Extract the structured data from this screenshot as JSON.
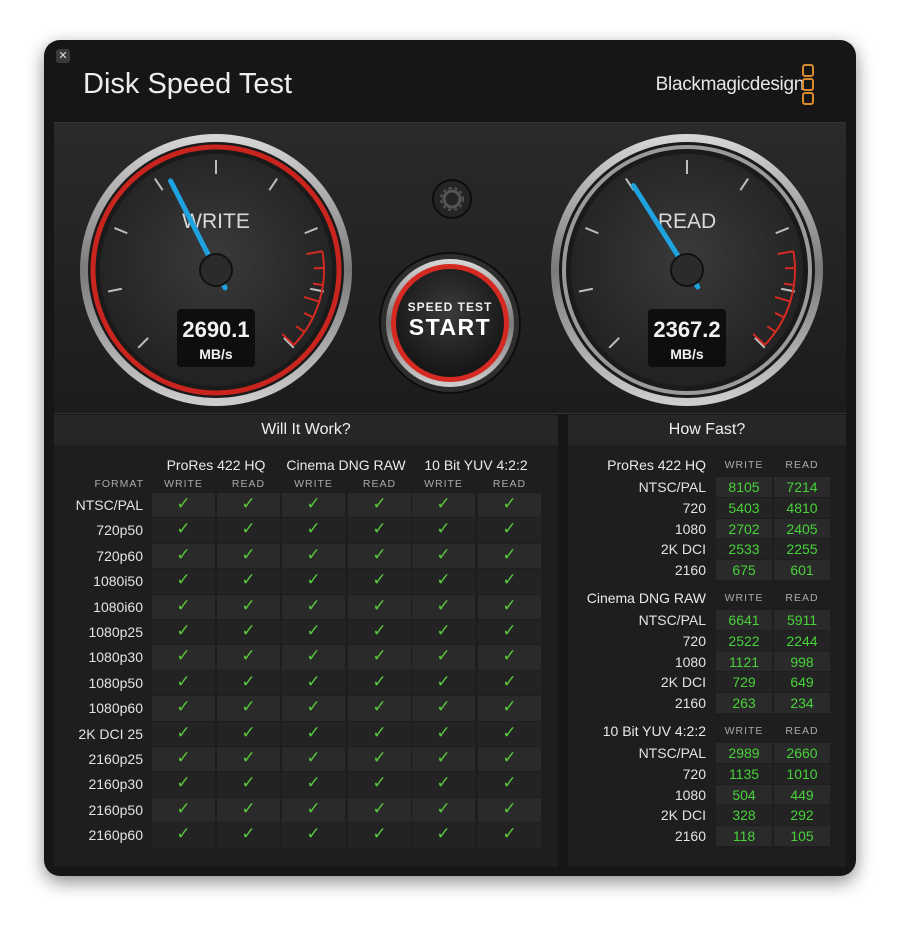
{
  "window": {
    "title": "Disk Speed Test",
    "brand": "Blackmagicdesign",
    "close_icon": "close-icon"
  },
  "gauges": {
    "write": {
      "label": "WRITE",
      "value": "2690.1",
      "unit": "MB/s",
      "needle_fraction": 0.4
    },
    "read": {
      "label": "READ",
      "value": "2367.2",
      "unit": "MB/s",
      "needle_fraction": 0.38
    }
  },
  "start_button": {
    "line1": "SPEED TEST",
    "line2": "START"
  },
  "settings_icon": "gear-icon",
  "will_it_work": {
    "title": "Will It Work?",
    "format_header": "FORMAT",
    "codecs": [
      "ProRes 422 HQ",
      "Cinema DNG RAW",
      "10 Bit YUV 4:2:2"
    ],
    "subcols": [
      "WRITE",
      "READ",
      "WRITE",
      "READ",
      "WRITE",
      "READ"
    ],
    "formats": [
      "NTSC/PAL",
      "720p50",
      "720p60",
      "1080i50",
      "1080i60",
      "1080p25",
      "1080p30",
      "1080p50",
      "1080p60",
      "2K DCI 25",
      "2160p25",
      "2160p30",
      "2160p50",
      "2160p60"
    ],
    "check_glyph": "✓"
  },
  "how_fast": {
    "title": "How Fast?",
    "write_label": "WRITE",
    "read_label": "READ",
    "groups": [
      {
        "codec": "ProRes 422 HQ",
        "rows": [
          {
            "format": "NTSC/PAL",
            "write": "8105",
            "read": "7214"
          },
          {
            "format": "720",
            "write": "5403",
            "read": "4810"
          },
          {
            "format": "1080",
            "write": "2702",
            "read": "2405"
          },
          {
            "format": "2K DCI",
            "write": "2533",
            "read": "2255"
          },
          {
            "format": "2160",
            "write": "675",
            "read": "601"
          }
        ]
      },
      {
        "codec": "Cinema DNG RAW",
        "rows": [
          {
            "format": "NTSC/PAL",
            "write": "6641",
            "read": "5911"
          },
          {
            "format": "720",
            "write": "2522",
            "read": "2244"
          },
          {
            "format": "1080",
            "write": "1121",
            "read": "998"
          },
          {
            "format": "2K DCI",
            "write": "729",
            "read": "649"
          },
          {
            "format": "2160",
            "write": "263",
            "read": "234"
          }
        ]
      },
      {
        "codec": "10 Bit YUV 4:2:2",
        "rows": [
          {
            "format": "NTSC/PAL",
            "write": "2989",
            "read": "2660"
          },
          {
            "format": "720",
            "write": "1135",
            "read": "1010"
          },
          {
            "format": "1080",
            "write": "504",
            "read": "449"
          },
          {
            "format": "2K DCI",
            "write": "328",
            "read": "292"
          },
          {
            "format": "2160",
            "write": "118",
            "read": "105"
          }
        ]
      }
    ]
  },
  "colors": {
    "accent_red": "#d42a22",
    "needle_blue": "#1fa3e0",
    "check_green": "#58c83c",
    "value_green": "#48d23a",
    "brand_orange": "#d88a2e"
  }
}
